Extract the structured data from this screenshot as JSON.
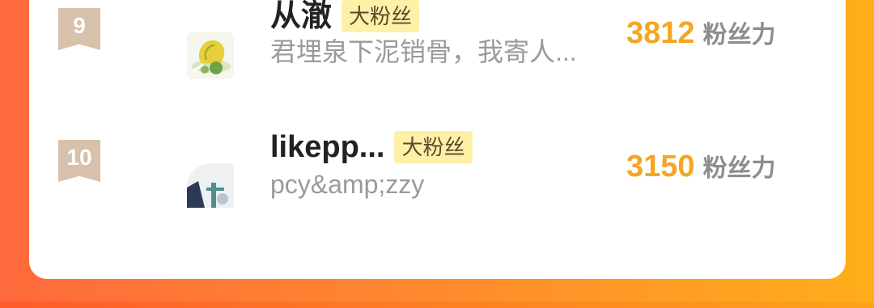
{
  "ranking": [
    {
      "rank": "9",
      "name": "从澈",
      "tag": "大粉丝",
      "description": "君埋泉下泥销骨，我寄人...",
      "score": "3812",
      "score_unit": "粉丝力",
      "avatar": "cartoon-leaf-avatar"
    },
    {
      "rank": "10",
      "name": "likepp...",
      "tag": "大粉丝",
      "description": "pcy&amp;zzy",
      "score": "3150",
      "score_unit": "粉丝力",
      "avatar": "photo-avatar"
    }
  ],
  "colors": {
    "accent_score": "#f5a623",
    "tag_background": "#fff0a8",
    "rank_badge": "#d7c1ab",
    "background_gradient_start": "#ff6a3d",
    "background_gradient_end": "#ffae1a"
  }
}
